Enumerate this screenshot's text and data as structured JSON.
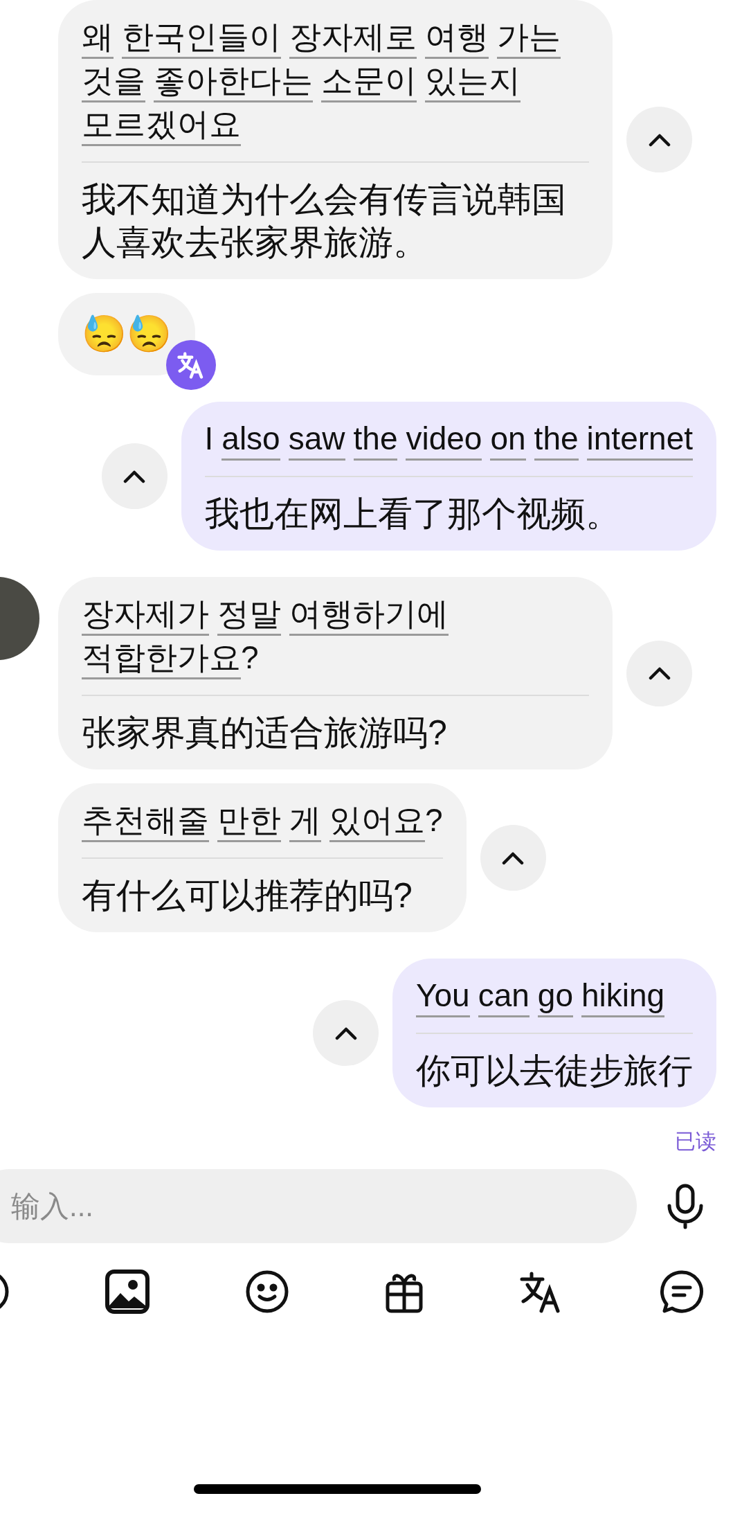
{
  "messages": [
    {
      "kind": "text",
      "outgoing": false,
      "show_avatar": false,
      "expanded": true,
      "original": [
        {
          "text": "왜",
          "underlined": true,
          "joined": false
        },
        {
          "text": "한국인들이",
          "underlined": true,
          "joined": false
        },
        {
          "text": "장자제로",
          "underlined": true,
          "joined": false
        },
        {
          "text": "여행",
          "underlined": true,
          "joined": false
        },
        {
          "text": "가는",
          "underlined": true,
          "joined": false
        },
        {
          "text": "것을",
          "underlined": true,
          "joined": false
        },
        {
          "text": "좋아한다는",
          "underlined": true,
          "joined": false
        },
        {
          "text": "소문이",
          "underlined": true,
          "joined": false
        },
        {
          "text": "있는지",
          "underlined": true,
          "joined": false
        },
        {
          "text": "모르겠어요",
          "underlined": true,
          "joined": false
        }
      ],
      "translation": "我不知道为什么会有传言说韩国人喜欢去张家界旅游。"
    },
    {
      "kind": "emoji",
      "outgoing": false,
      "show_avatar": false,
      "text": "😓😓",
      "translated_badge": true
    },
    {
      "kind": "text",
      "outgoing": true,
      "show_avatar": false,
      "expanded": true,
      "original": [
        {
          "text": "I",
          "underlined": false,
          "joined": false
        },
        {
          "text": "also",
          "underlined": true,
          "joined": false
        },
        {
          "text": "saw",
          "underlined": true,
          "joined": false
        },
        {
          "text": "the",
          "underlined": true,
          "joined": false
        },
        {
          "text": "video",
          "underlined": true,
          "joined": false
        },
        {
          "text": "on",
          "underlined": true,
          "joined": false
        },
        {
          "text": "the",
          "underlined": true,
          "joined": false
        },
        {
          "text": "internet",
          "underlined": true,
          "joined": false
        }
      ],
      "translation": "我也在网上看了那个视频。"
    },
    {
      "kind": "text",
      "outgoing": false,
      "show_avatar": true,
      "expanded": true,
      "original": [
        {
          "text": "장자제가",
          "underlined": true,
          "joined": false
        },
        {
          "text": "정말",
          "underlined": true,
          "joined": false
        },
        {
          "text": "여행하기에",
          "underlined": true,
          "joined": false
        },
        {
          "text": "적합한가요",
          "underlined": true,
          "joined": false
        },
        {
          "text": "?",
          "underlined": false,
          "joined": true
        }
      ],
      "translation": "张家界真的适合旅游吗?"
    },
    {
      "kind": "text",
      "outgoing": false,
      "show_avatar": false,
      "expanded": true,
      "original": [
        {
          "text": "추천해줄",
          "underlined": true,
          "joined": false
        },
        {
          "text": "만한",
          "underlined": true,
          "joined": false
        },
        {
          "text": "게",
          "underlined": true,
          "joined": false
        },
        {
          "text": "있어요",
          "underlined": true,
          "joined": false
        },
        {
          "text": "?",
          "underlined": false,
          "joined": true
        }
      ],
      "translation": "有什么可以推荐的吗?"
    },
    {
      "kind": "text",
      "outgoing": true,
      "show_avatar": false,
      "expanded": true,
      "original": [
        {
          "text": "You",
          "underlined": true,
          "joined": false
        },
        {
          "text": "can",
          "underlined": true,
          "joined": false
        },
        {
          "text": "go",
          "underlined": true,
          "joined": false
        },
        {
          "text": "hiking",
          "underlined": true,
          "joined": false
        }
      ],
      "translation": "你可以去徒步旅行"
    }
  ],
  "read_receipt": "已读",
  "composer": {
    "placeholder": "输入..."
  }
}
